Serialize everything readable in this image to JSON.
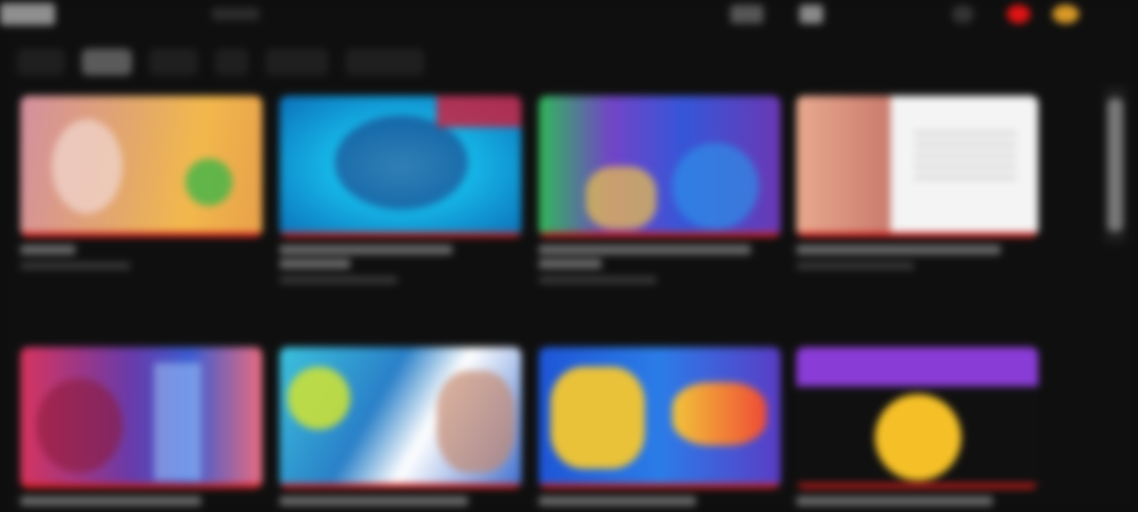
{
  "colors": {
    "background": "#0f0f0f",
    "chip_active": "#5a5a5a",
    "chip": "#1f1f1f",
    "progress": "#d51d1d",
    "notification": "#e01313"
  },
  "topbar": {
    "icons": [
      "logo-icon",
      "create-icon",
      "notifications-icon",
      "avatar-icon",
      "account-icon"
    ]
  },
  "chips": [
    "",
    "",
    "",
    "",
    "",
    "",
    ""
  ],
  "videos": [
    {
      "watched_fraction": 1.0
    },
    {
      "watched_fraction": 1.0
    },
    {
      "watched_fraction": 1.0
    },
    {
      "watched_fraction": 1.0
    },
    {
      "watched_fraction": 1.0
    },
    {
      "watched_fraction": 1.0
    },
    {
      "watched_fraction": 1.0
    },
    {
      "watched_fraction": 1.0
    }
  ]
}
